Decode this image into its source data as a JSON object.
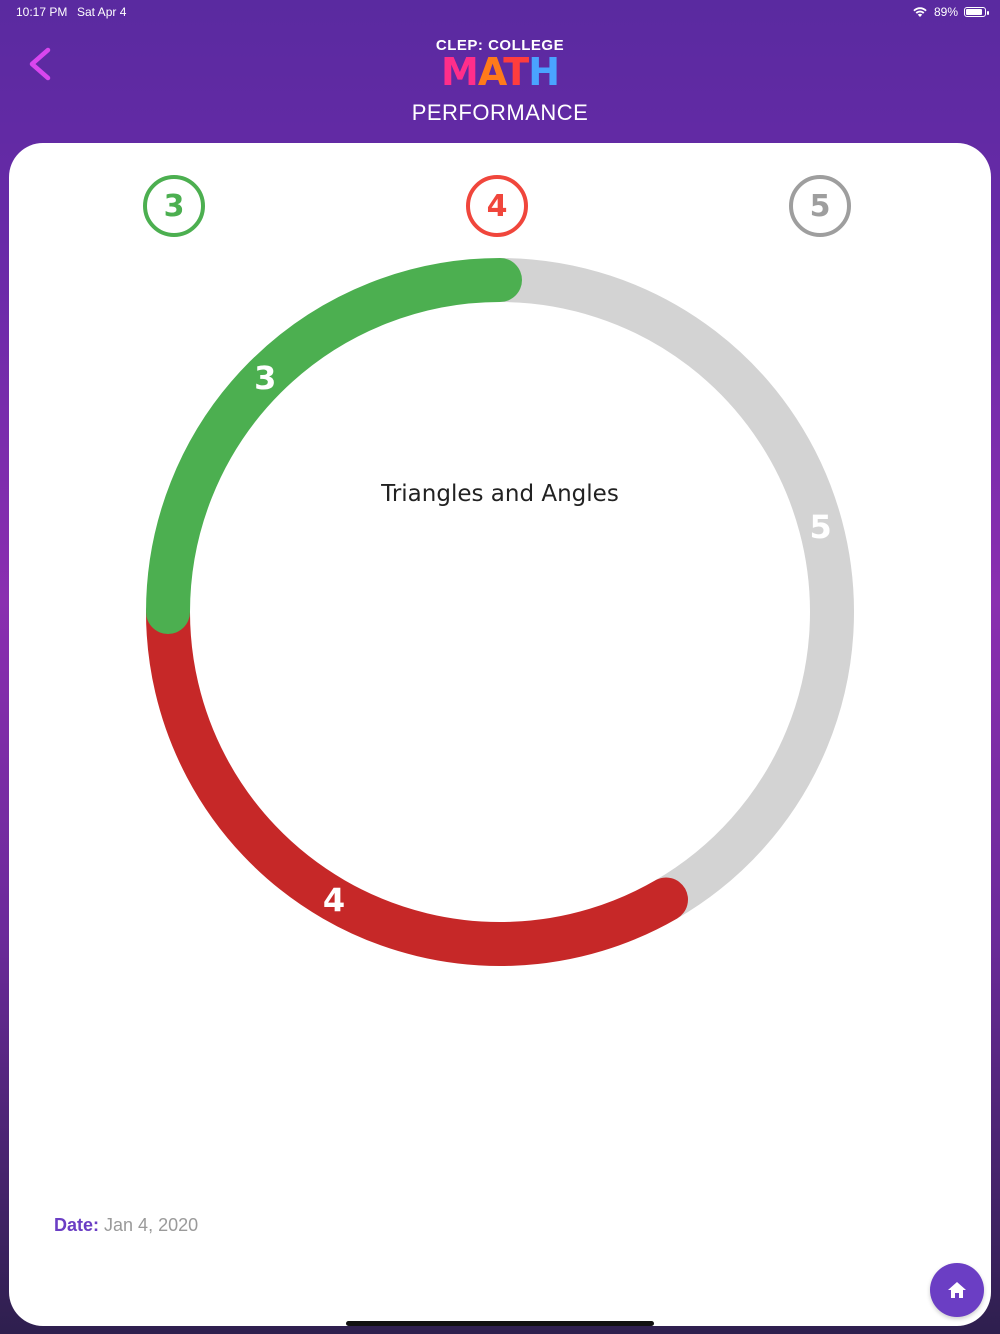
{
  "status_bar": {
    "time": "10:17 PM",
    "date": "Sat Apr 4",
    "battery": "89%"
  },
  "header": {
    "logo_top": "CLEP: COLLEGE",
    "logo_math": [
      "M",
      "A",
      "T",
      "H"
    ],
    "title": "PERFORMANCE"
  },
  "badges": [
    {
      "label": "3",
      "color": "#4caf50"
    },
    {
      "label": "4",
      "color": "#f0463c"
    },
    {
      "label": "5",
      "color": "#9e9e9e"
    }
  ],
  "chart_data": {
    "type": "donut",
    "title": "Triangles and Angles",
    "categories": [
      "3",
      "4",
      "5"
    ],
    "values": [
      3,
      4,
      5
    ],
    "colors": [
      "#4caf50",
      "#c62828",
      "#d3d3d3"
    ],
    "label_colors": [
      "#ffffff",
      "#ffffff",
      "#ffffff"
    ]
  },
  "date": {
    "label": "Date:",
    "value": "Jan 4, 2020"
  }
}
